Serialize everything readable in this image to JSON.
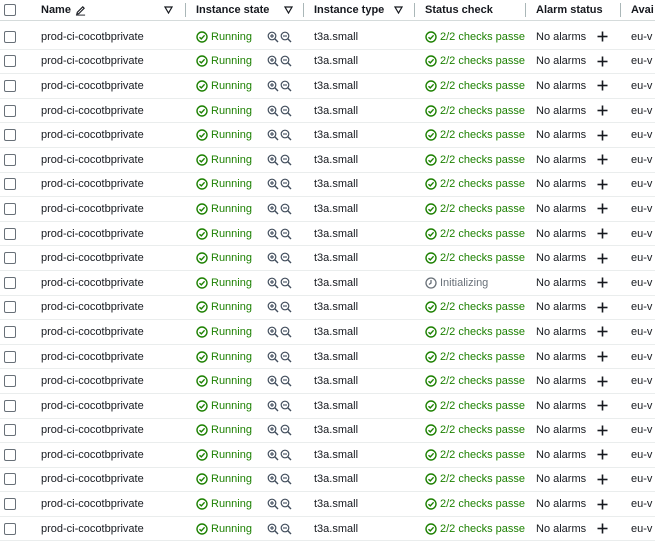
{
  "columns": {
    "name": "Name",
    "state": "Instance state",
    "type": "Instance type",
    "status": "Status check",
    "alarm": "Alarm status",
    "az": "Avai"
  },
  "rows": [
    {
      "name": "prod-ci-cocotbprivate",
      "state": "Running",
      "type": "t3a.small",
      "status": "2/2 checks passed",
      "status_kind": "passed",
      "alarm": "No alarms",
      "az": "eu-v"
    },
    {
      "name": "prod-ci-cocotbprivate",
      "state": "Running",
      "type": "t3a.small",
      "status": "2/2 checks passed",
      "status_kind": "passed",
      "alarm": "No alarms",
      "az": "eu-v"
    },
    {
      "name": "prod-ci-cocotbprivate",
      "state": "Running",
      "type": "t3a.small",
      "status": "2/2 checks passed",
      "status_kind": "passed",
      "alarm": "No alarms",
      "az": "eu-v"
    },
    {
      "name": "prod-ci-cocotbprivate",
      "state": "Running",
      "type": "t3a.small",
      "status": "2/2 checks passed",
      "status_kind": "passed",
      "alarm": "No alarms",
      "az": "eu-v"
    },
    {
      "name": "prod-ci-cocotbprivate",
      "state": "Running",
      "type": "t3a.small",
      "status": "2/2 checks passed",
      "status_kind": "passed",
      "alarm": "No alarms",
      "az": "eu-v"
    },
    {
      "name": "prod-ci-cocotbprivate",
      "state": "Running",
      "type": "t3a.small",
      "status": "2/2 checks passed",
      "status_kind": "passed",
      "alarm": "No alarms",
      "az": "eu-v"
    },
    {
      "name": "prod-ci-cocotbprivate",
      "state": "Running",
      "type": "t3a.small",
      "status": "2/2 checks passed",
      "status_kind": "passed",
      "alarm": "No alarms",
      "az": "eu-v"
    },
    {
      "name": "prod-ci-cocotbprivate",
      "state": "Running",
      "type": "t3a.small",
      "status": "2/2 checks passed",
      "status_kind": "passed",
      "alarm": "No alarms",
      "az": "eu-v"
    },
    {
      "name": "prod-ci-cocotbprivate",
      "state": "Running",
      "type": "t3a.small",
      "status": "2/2 checks passed",
      "status_kind": "passed",
      "alarm": "No alarms",
      "az": "eu-v"
    },
    {
      "name": "prod-ci-cocotbprivate",
      "state": "Running",
      "type": "t3a.small",
      "status": "2/2 checks passed",
      "status_kind": "passed",
      "alarm": "No alarms",
      "az": "eu-v"
    },
    {
      "name": "prod-ci-cocotbprivate",
      "state": "Running",
      "type": "t3a.small",
      "status": "Initializing",
      "status_kind": "initializing",
      "alarm": "No alarms",
      "az": "eu-v"
    },
    {
      "name": "prod-ci-cocotbprivate",
      "state": "Running",
      "type": "t3a.small",
      "status": "2/2 checks passed",
      "status_kind": "passed",
      "alarm": "No alarms",
      "az": "eu-v"
    },
    {
      "name": "prod-ci-cocotbprivate",
      "state": "Running",
      "type": "t3a.small",
      "status": "2/2 checks passed",
      "status_kind": "passed",
      "alarm": "No alarms",
      "az": "eu-v"
    },
    {
      "name": "prod-ci-cocotbprivate",
      "state": "Running",
      "type": "t3a.small",
      "status": "2/2 checks passed",
      "status_kind": "passed",
      "alarm": "No alarms",
      "az": "eu-v"
    },
    {
      "name": "prod-ci-cocotbprivate",
      "state": "Running",
      "type": "t3a.small",
      "status": "2/2 checks passed",
      "status_kind": "passed",
      "alarm": "No alarms",
      "az": "eu-v"
    },
    {
      "name": "prod-ci-cocotbprivate",
      "state": "Running",
      "type": "t3a.small",
      "status": "2/2 checks passed",
      "status_kind": "passed",
      "alarm": "No alarms",
      "az": "eu-v"
    },
    {
      "name": "prod-ci-cocotbprivate",
      "state": "Running",
      "type": "t3a.small",
      "status": "2/2 checks passed",
      "status_kind": "passed",
      "alarm": "No alarms",
      "az": "eu-v"
    },
    {
      "name": "prod-ci-cocotbprivate",
      "state": "Running",
      "type": "t3a.small",
      "status": "2/2 checks passed",
      "status_kind": "passed",
      "alarm": "No alarms",
      "az": "eu-v"
    },
    {
      "name": "prod-ci-cocotbprivate",
      "state": "Running",
      "type": "t3a.small",
      "status": "2/2 checks passed",
      "status_kind": "passed",
      "alarm": "No alarms",
      "az": "eu-v"
    },
    {
      "name": "prod-ci-cocotbprivate",
      "state": "Running",
      "type": "t3a.small",
      "status": "2/2 checks passed",
      "status_kind": "passed",
      "alarm": "No alarms",
      "az": "eu-v"
    },
    {
      "name": "prod-ci-cocotbprivate",
      "state": "Running",
      "type": "t3a.small",
      "status": "2/2 checks passed",
      "status_kind": "passed",
      "alarm": "No alarms",
      "az": "eu-v"
    }
  ],
  "colors": {
    "success": "#1d8102",
    "muted": "#687078",
    "border": "#eaeded"
  },
  "icons": {
    "running": "check-circle-icon",
    "passed": "check-circle-icon",
    "initializing": "clock-icon",
    "zoom_in": "zoom-in-icon",
    "zoom_out": "zoom-out-icon",
    "add": "plus-icon",
    "edit": "pencil-icon",
    "sort": "sort-caret-icon"
  }
}
